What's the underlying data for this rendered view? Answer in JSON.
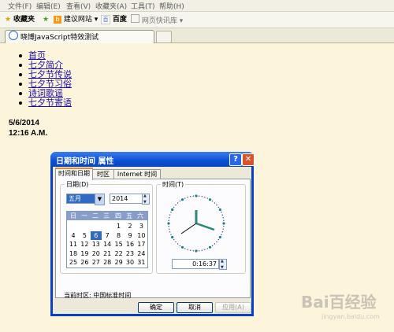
{
  "menubar": [
    "文件(F)",
    "编辑(E)",
    "查看(V)",
    "收藏夹(A)",
    "工具(T)",
    "帮助(H)"
  ],
  "favbar": {
    "favorites": "收藏夹",
    "suggested": "建议网站 ▾",
    "baidu": "百度",
    "slices": "网页快讯库 ▾"
  },
  "tab": {
    "title": "晓博JavaScript特效测试"
  },
  "nav": [
    "首页",
    "七夕简介",
    "七夕节传说",
    "七夕节习俗",
    "诗词歌谣",
    "七夕节寄语"
  ],
  "page": {
    "date": "5/6/2014",
    "time": "12:16 A.M."
  },
  "dialog": {
    "title": "日期和时间 属性",
    "tabs": [
      "时间和日期",
      "时区",
      "Internet 时间"
    ],
    "date_group": "日期(D)",
    "time_group": "时间(T)",
    "month": "五月",
    "year": "2014",
    "weekdays": [
      "日",
      "一",
      "二",
      "三",
      "四",
      "五",
      "六"
    ],
    "days": [
      [
        "",
        "",
        "",
        "",
        "1",
        "2",
        "3"
      ],
      [
        "4",
        "5",
        "6",
        "7",
        "8",
        "9",
        "10"
      ],
      [
        "11",
        "12",
        "13",
        "14",
        "15",
        "16",
        "17"
      ],
      [
        "18",
        "19",
        "20",
        "21",
        "22",
        "23",
        "24"
      ],
      [
        "25",
        "26",
        "27",
        "28",
        "29",
        "30",
        "31"
      ]
    ],
    "selected_day": "6",
    "time_value": "0:16:37",
    "timezone": "当前时区: 中国标准时间",
    "ok": "确定",
    "cancel": "取消",
    "apply": "应用(A)"
  },
  "watermark": {
    "main": "Bai百经验",
    "sub": "jingyan.baidu.com"
  },
  "colors": {
    "accent": "#316ac5",
    "titlebar": "#0b4fd3",
    "page_bg": "#fdf4dc"
  }
}
